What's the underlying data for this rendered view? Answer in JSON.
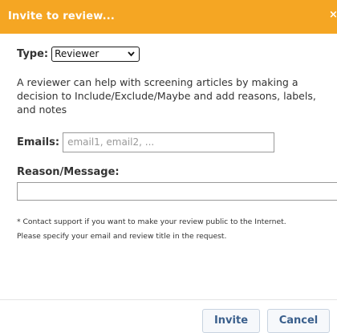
{
  "dialog": {
    "title": "Invite to review...",
    "close_glyph": "×"
  },
  "type_field": {
    "label": "Type:",
    "selected": "Reviewer"
  },
  "description": "A reviewer can help with screening articles by making a decision to Include/Exclude/Maybe and add reasons, labels, and notes",
  "emails": {
    "label": "Emails:",
    "placeholder": "email1, email2, ...",
    "value": ""
  },
  "reason": {
    "label": "Reason/Message:",
    "value": ""
  },
  "note": {
    "line1": "* Contact support if you want to make your review public to the Internet.",
    "line2": "Please specify your email and review title in the request."
  },
  "buttons": {
    "invite": "Invite",
    "cancel": "Cancel"
  },
  "colors": {
    "title_bar": "#f5a623",
    "button_text": "#3a5f8c"
  }
}
